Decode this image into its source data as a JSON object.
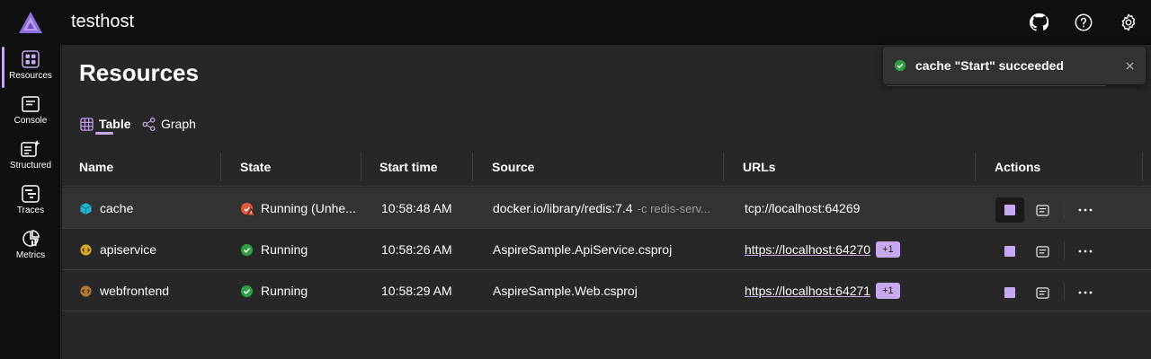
{
  "app": {
    "title": "testhost"
  },
  "nav": [
    {
      "label": "Resources",
      "icon": "resources-icon"
    },
    {
      "label": "Console",
      "icon": "console-icon"
    },
    {
      "label": "Structured",
      "icon": "structured-icon"
    },
    {
      "label": "Traces",
      "icon": "traces-icon"
    },
    {
      "label": "Metrics",
      "icon": "metrics-icon"
    }
  ],
  "page": {
    "title": "Resources"
  },
  "tabs": [
    {
      "label": "Table",
      "icon": "table-icon",
      "active": true
    },
    {
      "label": "Graph",
      "icon": "graph-icon",
      "active": false
    }
  ],
  "table": {
    "headers": [
      "Name",
      "State",
      "Start time",
      "Source",
      "URLs",
      "Actions"
    ],
    "rows": [
      {
        "name": "cache",
        "state": "Running (Unhe...",
        "start_time": "10:58:48 AM",
        "source": "docker.io/library/redis:7.4",
        "source_args": "-c redis-serv...",
        "url": "tcp://localhost:64269",
        "url_badge": ""
      },
      {
        "name": "apiservice",
        "state": "Running",
        "start_time": "10:58:26 AM",
        "source": "AspireSample.ApiService.csproj",
        "source_args": "",
        "url": "https://localhost:64270",
        "url_badge": "+1"
      },
      {
        "name": "webfrontend",
        "state": "Running",
        "start_time": "10:58:29 AM",
        "source": "AspireSample.Web.csproj",
        "source_args": "",
        "url": "https://localhost:64271",
        "url_badge": "+1"
      }
    ]
  },
  "toast": {
    "message": "cache \"Start\" succeeded"
  },
  "colors": {
    "accent": "#c8a8f0",
    "success": "#2ea043",
    "warning": "#d9534f"
  }
}
